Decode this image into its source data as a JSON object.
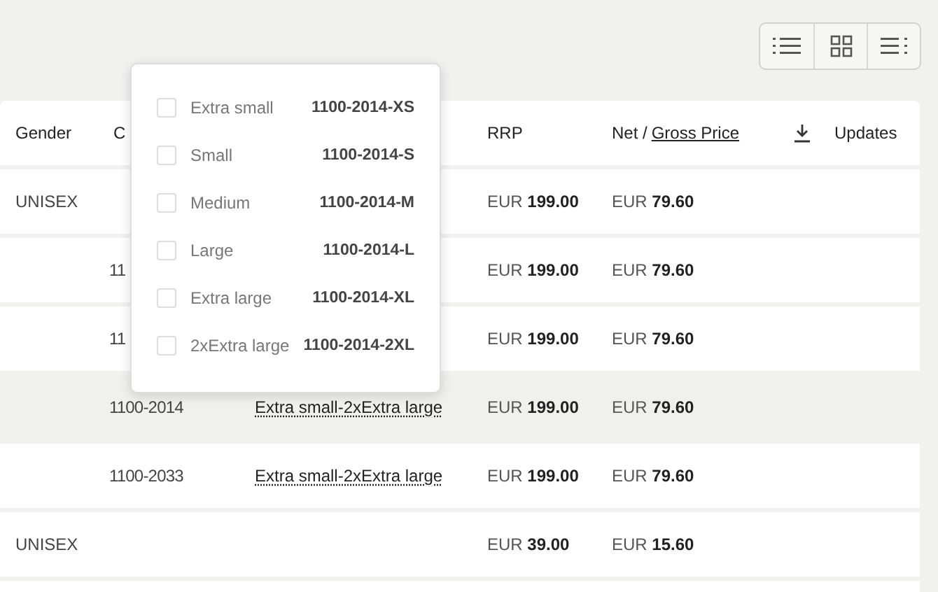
{
  "table": {
    "columns": [
      {
        "kind": "text",
        "label": "Gender"
      },
      {
        "kind": "text",
        "label": "C"
      },
      {
        "kind": "blank"
      },
      {
        "kind": "text",
        "label": "RRP"
      },
      {
        "kind": "split",
        "label": "Net /",
        "link": "Gross Price"
      },
      {
        "kind": "download"
      },
      {
        "kind": "text",
        "label": "Updates"
      }
    ],
    "rows": [
      {
        "gender": "UNISEX",
        "rrp": "EUR **199.00**",
        "net": "EUR **79.60**",
        "highlighted": false
      },
      {
        "column_2": "11",
        "rrp": "EUR **199.00**",
        "net": "EUR **79.60**",
        "highlighted": false
      },
      {
        "column_2": "11",
        "rrp": "EUR **199.00**",
        "net": "EUR **79.60**",
        "highlighted": false
      },
      {
        "column_2": "1100-2014",
        "sizes": "Extra small-2xExtra large",
        "rrp": "EUR **199.00**",
        "net": "EUR **79.60**",
        "highlighted": true
      },
      {
        "column_2": "1100-2033",
        "sizes": "Extra small-2xExtra large",
        "rrp": "EUR **199.00**",
        "net": "EUR **79.60**",
        "highlighted": false
      },
      {
        "gender": "UNISEX",
        "rrp": "EUR **39.00**",
        "net": "EUR **15.60**",
        "highlighted": false
      }
    ]
  },
  "size_dropdown": {
    "items": [
      {
        "label": "Extra small",
        "code": "1100-2014-XS",
        "checked": false
      },
      {
        "label": "Small",
        "code": "1100-2014-S",
        "checked": false
      },
      {
        "label": "Medium",
        "code": "1100-2014-M",
        "checked": false
      },
      {
        "label": "Large",
        "code": "1100-2014-L",
        "checked": false
      },
      {
        "label": "Extra large",
        "code": "1100-2014-XL",
        "checked": false
      },
      {
        "label": "2xExtra large",
        "code": "1100-2014-2XL",
        "checked": false
      }
    ]
  }
}
